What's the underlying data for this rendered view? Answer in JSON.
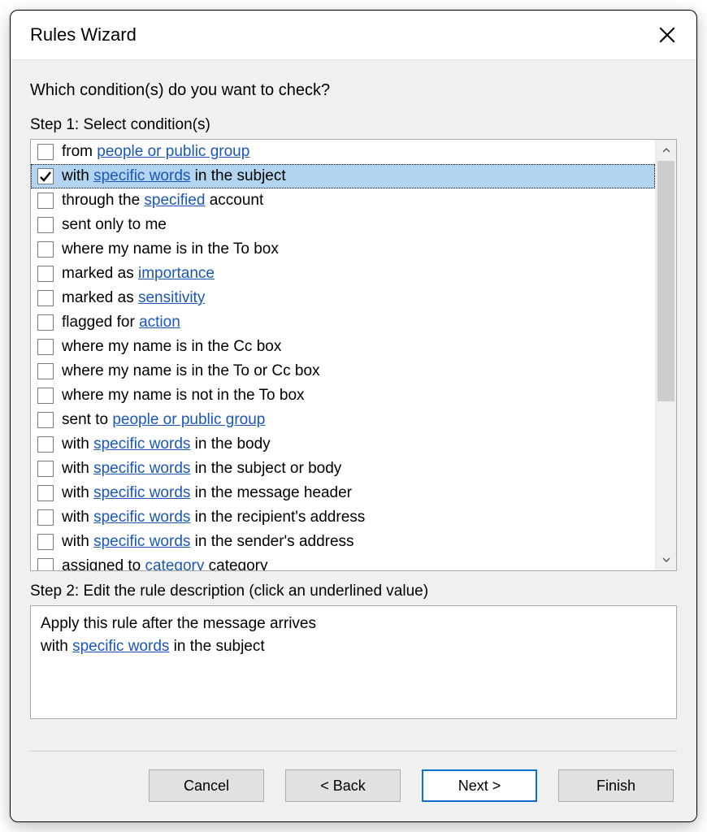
{
  "dialog": {
    "title": "Rules Wizard",
    "question": "Which condition(s) do you want to check?",
    "step1_label": "Step 1: Select condition(s)",
    "step2_label": "Step 2: Edit the rule description (click an underlined value)"
  },
  "conditions": [
    {
      "checked": false,
      "selected": false,
      "parts": [
        {
          "t": "from "
        },
        {
          "t": "people or public group",
          "link": true
        }
      ]
    },
    {
      "checked": true,
      "selected": true,
      "parts": [
        {
          "t": "with "
        },
        {
          "t": "specific words",
          "link": true
        },
        {
          "t": " in the subject"
        }
      ]
    },
    {
      "checked": false,
      "selected": false,
      "parts": [
        {
          "t": "through the "
        },
        {
          "t": "specified",
          "link": true
        },
        {
          "t": " account"
        }
      ]
    },
    {
      "checked": false,
      "selected": false,
      "parts": [
        {
          "t": "sent only to me"
        }
      ]
    },
    {
      "checked": false,
      "selected": false,
      "parts": [
        {
          "t": "where my name is in the To box"
        }
      ]
    },
    {
      "checked": false,
      "selected": false,
      "parts": [
        {
          "t": "marked as "
        },
        {
          "t": "importance",
          "link": true
        }
      ]
    },
    {
      "checked": false,
      "selected": false,
      "parts": [
        {
          "t": "marked as "
        },
        {
          "t": "sensitivity",
          "link": true
        }
      ]
    },
    {
      "checked": false,
      "selected": false,
      "parts": [
        {
          "t": "flagged for "
        },
        {
          "t": "action",
          "link": true
        }
      ]
    },
    {
      "checked": false,
      "selected": false,
      "parts": [
        {
          "t": "where my name is in the Cc box"
        }
      ]
    },
    {
      "checked": false,
      "selected": false,
      "parts": [
        {
          "t": "where my name is in the To or Cc box"
        }
      ]
    },
    {
      "checked": false,
      "selected": false,
      "parts": [
        {
          "t": "where my name is not in the To box"
        }
      ]
    },
    {
      "checked": false,
      "selected": false,
      "parts": [
        {
          "t": "sent to "
        },
        {
          "t": "people or public group",
          "link": true
        }
      ]
    },
    {
      "checked": false,
      "selected": false,
      "parts": [
        {
          "t": "with "
        },
        {
          "t": "specific words",
          "link": true
        },
        {
          "t": " in the body"
        }
      ]
    },
    {
      "checked": false,
      "selected": false,
      "parts": [
        {
          "t": "with "
        },
        {
          "t": "specific words",
          "link": true
        },
        {
          "t": " in the subject or body"
        }
      ]
    },
    {
      "checked": false,
      "selected": false,
      "parts": [
        {
          "t": "with "
        },
        {
          "t": "specific words",
          "link": true
        },
        {
          "t": " in the message header"
        }
      ]
    },
    {
      "checked": false,
      "selected": false,
      "parts": [
        {
          "t": "with "
        },
        {
          "t": "specific words",
          "link": true
        },
        {
          "t": " in the recipient's address"
        }
      ]
    },
    {
      "checked": false,
      "selected": false,
      "parts": [
        {
          "t": "with "
        },
        {
          "t": "specific words",
          "link": true
        },
        {
          "t": " in the sender's address"
        }
      ]
    },
    {
      "checked": false,
      "selected": false,
      "parts": [
        {
          "t": "assigned to "
        },
        {
          "t": "category",
          "link": true
        },
        {
          "t": " category"
        }
      ]
    }
  ],
  "description": {
    "line1": "Apply this rule after the message arrives",
    "line2_pre": "with ",
    "line2_link": "specific words",
    "line2_post": " in the subject"
  },
  "buttons": {
    "cancel": "Cancel",
    "back": "< Back",
    "next": "Next >",
    "finish": "Finish"
  }
}
